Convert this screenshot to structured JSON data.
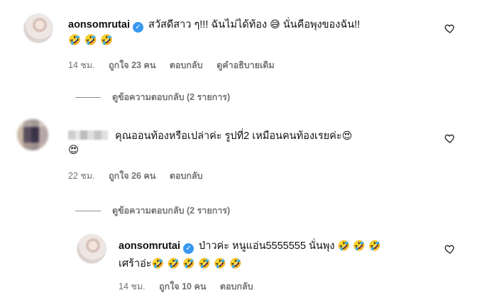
{
  "comment1": {
    "username": "aonsomrutai",
    "text": "สวัสดีสาว ๆ!!! ฉันไม่ได้ท้อง",
    "emoji_a": "😅",
    "text_b": " นั่นคือพุงของฉัน!!",
    "emoji_line2": "🤣 🤣 🤣",
    "time": "14 ชม.",
    "likes": "ถูกใจ 23 คน",
    "reply": "ตอบกลับ",
    "see_translation": "ดูคำอธิบายเดิม",
    "view_replies": "ดูข้อความตอบกลับ (2 รายการ)"
  },
  "comment2": {
    "text": "คุณออนท้องหรือเปล่าค่ะ รูปที่2 เหมือนคนท้องเรยค่ะ",
    "emoji_a": "😍",
    "emoji_line2": "😍",
    "time": "22 ชม.",
    "likes": "ถูกใจ 26 คน",
    "reply": "ตอบกลับ",
    "view_replies": "ดูข้อความตอบกลับ (2 รายการ)"
  },
  "comment3": {
    "username": "aonsomrutai",
    "text": "ป่าวค่ะ หนูแอ่น5555555 นั่นพุง",
    "emoji_a": "🤣 🤣 🤣",
    "line2_text": "เศร้าอ่ะ",
    "emoji_line2": "🤣 🤣 🤣 🤣 🤣 🤣",
    "time": "14 ชม.",
    "likes": "ถูกใจ 10 คน",
    "reply": "ตอบกลับ"
  },
  "icons": {
    "verified": "✓",
    "heart": "heart-outline-icon"
  }
}
